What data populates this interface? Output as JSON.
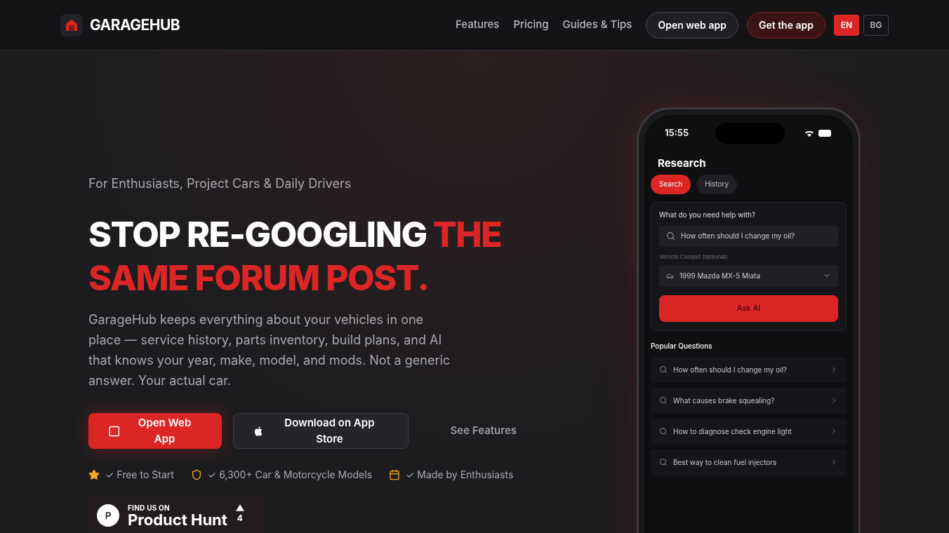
{
  "nav": {
    "brand": "GARAGEHUB",
    "links": [
      "Features",
      "Pricing",
      "Guides & Tips"
    ],
    "open_web_app": "Open web app",
    "get_app": "Get the app",
    "languages": [
      {
        "label": "EN",
        "selected": true
      },
      {
        "label": "BG",
        "selected": false
      }
    ]
  },
  "hero": {
    "eyebrow": "For Enthusiasts, Project Cars & Daily Drivers",
    "headline_plain": "STOP RE-GOOGLING",
    "headline_accent": "THE SAME FORUM POST.",
    "description": "GarageHub keeps everything about your vehicles in one place — service history, parts inventory, build plans, and AI that knows your year, make, model, and mods. Not a generic answer. Your actual car.",
    "buttons": [
      {
        "kind": "primary",
        "label": "Open Web App"
      },
      {
        "kind": "store",
        "label": "Download on App Store"
      },
      {
        "kind": "link",
        "label": "See Features"
      }
    ],
    "features": [
      {
        "kind": "star",
        "label": "✓ Free to Start"
      },
      {
        "kind": "shield",
        "label": "✓ 6,300+ Car & Motorcycle Models"
      },
      {
        "kind": "calendar",
        "label": "✓ Made by Enthusiasts"
      }
    ],
    "product_hunt": {
      "eyebrow": "FIND US ON",
      "name": "Product Hunt",
      "votes": "4"
    }
  },
  "phone": {
    "time": "15:55",
    "title": "Research",
    "tabs": [
      {
        "label": "Search",
        "selected": true
      },
      {
        "label": "History",
        "selected": false
      }
    ],
    "form": {
      "question_label": "What do you need help with?",
      "question_value": "How often should I change my oil?",
      "vehicle_label": "Vehicle Context (optional)",
      "vehicle_value": "1999 Mazda MX-5 Miata",
      "submit": "Ask AI"
    },
    "popular_title": "Popular Questions",
    "popular": [
      "How often should I change my oil?",
      "What causes brake squealing?",
      "How to diagnose check engine light",
      "Best way to clean fuel injectors"
    ]
  }
}
